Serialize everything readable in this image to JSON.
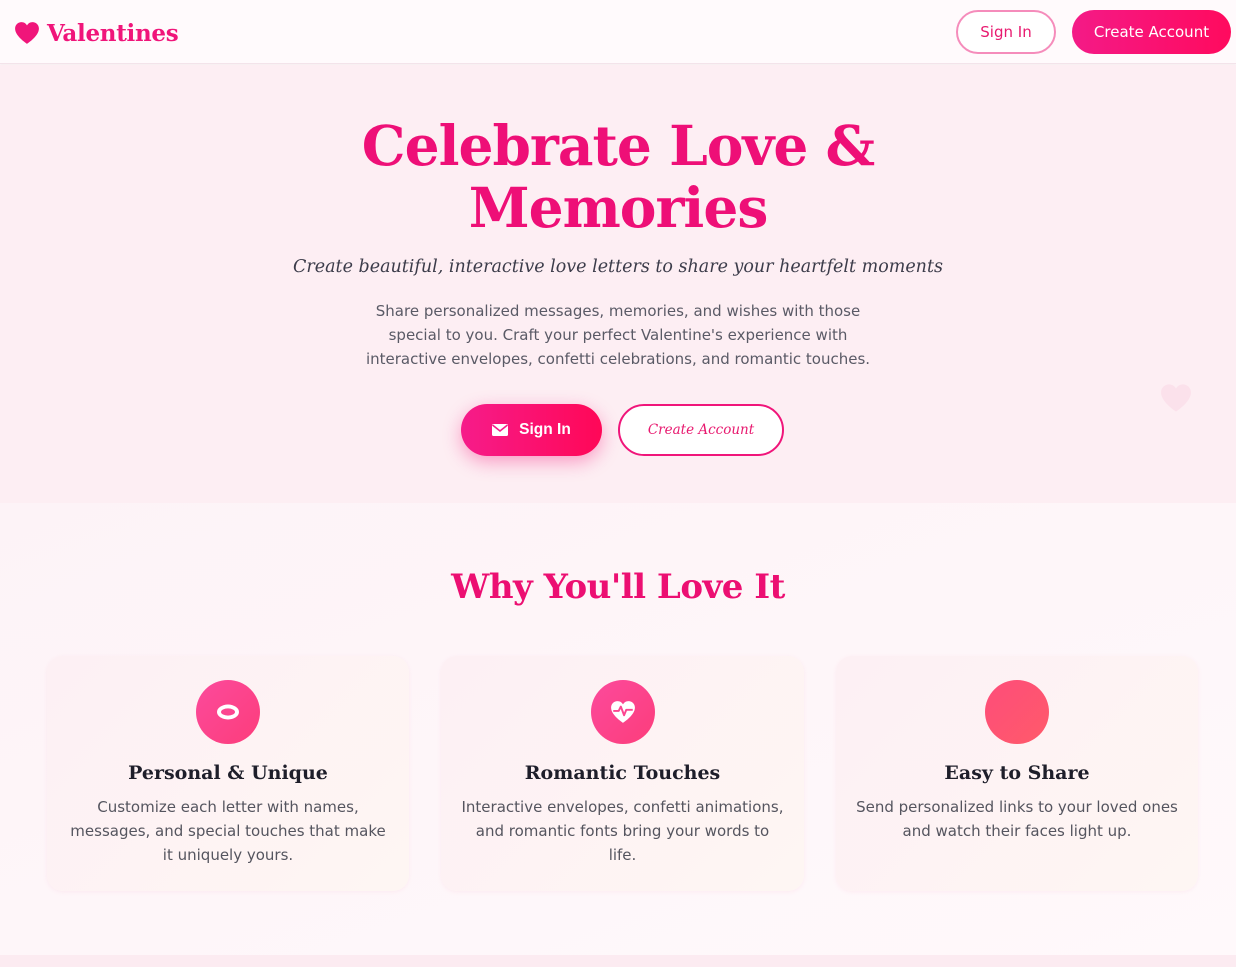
{
  "nav": {
    "brand": "Valentines",
    "brand_icon": "heart-icon",
    "sign_in": "Sign In",
    "create_account": "Create Account"
  },
  "hero": {
    "title": "Celebrate Love & Memories",
    "subtitle": "Create beautiful, interactive love letters to share your heartfelt moments",
    "description": "Share personalized messages, memories, and wishes with those special to you. Craft your perfect Valentine's experience with interactive envelopes, confetti celebrations, and romantic touches.",
    "sign_in": "Sign In",
    "sign_in_icon": "envelope-icon",
    "create_account": "Create Account"
  },
  "features": {
    "title": "Why You'll Love It",
    "cards": [
      {
        "icon": "ring-icon",
        "title": "Personal & Unique",
        "text": "Customize each letter with names, messages, and special touches that make it uniquely yours."
      },
      {
        "icon": "heartbeat-icon",
        "title": "Romantic Touches",
        "text": "Interactive envelopes, confetti animations, and romantic fonts bring your words to life."
      },
      {
        "icon": "share-icon",
        "title": "Easy to Share",
        "text": "Send personalized links to your loved ones and watch their faces light up."
      }
    ]
  },
  "colors": {
    "accent": "#f0157a",
    "accent_gradient_end": "#ff0a5e",
    "hero_bg": "#fdeef3",
    "text_dark": "#1e1e2a"
  }
}
